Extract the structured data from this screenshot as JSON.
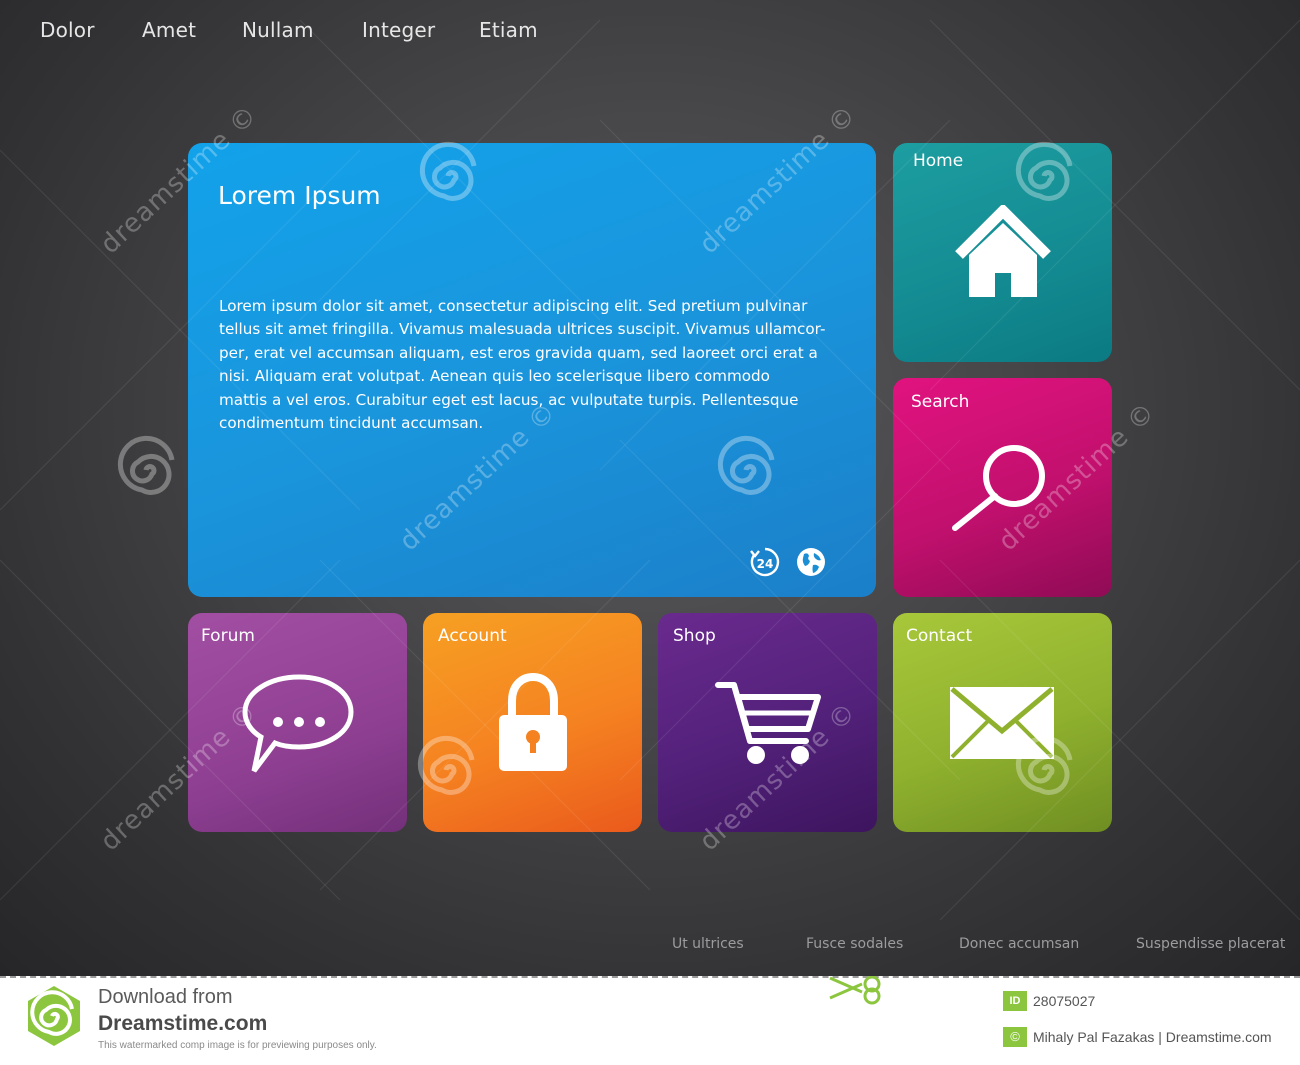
{
  "top_nav": [
    "Dolor",
    "Amet",
    "Nullam",
    "Integer",
    "Etiam"
  ],
  "hero": {
    "title": "Lorem Ipsum",
    "body_lines": [
      "Lorem ipsum dolor sit amet, consectetur adipiscing elit. Sed pretium pulvinar",
      "tellus sit amet fringilla. Vivamus malesuada ultrices suscipit. Vivamus ullamcor-",
      "per, erat vel accumsan aliquam, est eros gravida quam, sed laoreet orci erat a",
      "nisi. Aliquam erat volutpat. Aenean quis leo scelerisque libero commodo",
      "mattis a vel eros. Curabitur eget est lacus, ac vulputate turpis. Pellentesque",
      "condimentum tincidunt accumsan."
    ],
    "icons": [
      "24-hour-icon",
      "globe-icon"
    ]
  },
  "tiles": {
    "home": {
      "label": "Home",
      "icon": "home-icon",
      "color": "#138a91"
    },
    "search": {
      "label": "Search",
      "icon": "magnifier-icon",
      "color": "#c2106e"
    },
    "forum": {
      "label": "Forum",
      "icon": "speech-bubble-icon",
      "color": "#8f3f92"
    },
    "account": {
      "label": "Account",
      "icon": "padlock-icon",
      "color": "#f58221"
    },
    "shop": {
      "label": "Shop",
      "icon": "shopping-cart-icon",
      "color": "#52217a"
    },
    "contact": {
      "label": "Contact",
      "icon": "envelope-icon",
      "color": "#8fb12e"
    }
  },
  "footer_nav": [
    "Ut ultrices",
    "Fusce sodales",
    "Donec accumsan",
    "Suspendisse placerat"
  ],
  "watermark": {
    "text": "dreamstime",
    "symbol": "©"
  },
  "banner": {
    "line1": "Download from",
    "line2": "Dreamstime.com",
    "line3": "This watermarked comp image is for previewing purposes only.",
    "id_label": "ID",
    "id_value": "28075027",
    "copyright_symbol": "©",
    "credit": "Mihaly Pal Fazakas | Dreamstime.com",
    "accent_color": "#8cc63f"
  }
}
